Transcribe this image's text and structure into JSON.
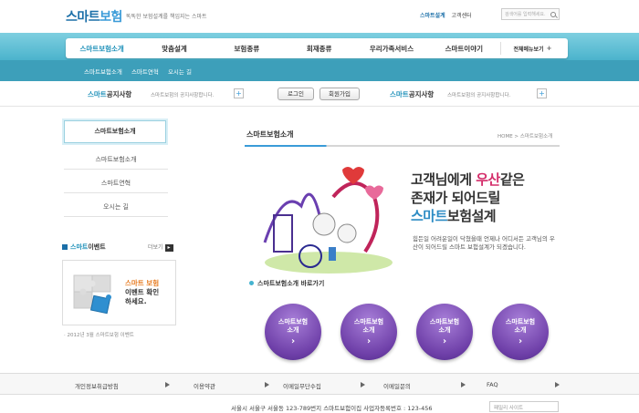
{
  "header": {
    "logo_prefix": "스마트",
    "logo_suffix": "보험",
    "tagline": "똑똑한 보험설계를 책임지는 스마트",
    "top_links": [
      "스마트설계",
      "고객센터"
    ],
    "search_placeholder": "검색어를 입력해세요."
  },
  "nav": {
    "items": [
      "스마트보험소개",
      "맞춤설계",
      "보험종류",
      "회재종류",
      "우리가족서비스",
      "스마트이야기"
    ],
    "all_menu": "전체메뉴보기"
  },
  "subnav": {
    "items": [
      "스마트보험소개",
      "스마트연혁",
      "오시는 길"
    ]
  },
  "notice_bar": {
    "left_title_hl": "스마트",
    "left_title": "공지사항",
    "left_text": "스마트보험의 공지사항합니다.",
    "login": "로그인",
    "join": "회원가입",
    "right_title_hl": "스마트",
    "right_title": "공지사항",
    "right_text": "스마트보험의 공지사항합니다."
  },
  "sidebar": {
    "title": "스마트보험소개",
    "items": [
      "스마트보험소개",
      "스마트연혁",
      "오시는 길"
    ],
    "event_title_hl": "스마트",
    "event_title": "이벤트",
    "more": "더보기",
    "event_line1": "스마트 보험",
    "event_line2": "이벤트 확인",
    "event_line3": "하세요.",
    "event_caption": "· 2012년 3월 스마트보험 이벤트"
  },
  "content": {
    "title": "스마트보험소개",
    "breadcrumb": "HOME > 스마트보험소개",
    "hero_l1_a": "고객님에게 ",
    "hero_l1_hl": "우산",
    "hero_l1_b": "같은",
    "hero_l2": "존재가 되어드릴",
    "hero_l3_hl": "스마트",
    "hero_l3": "보험설계",
    "hero_desc": "힘든일 어려운일이 닥쳤을때 언제나 어디서든 고객님의 우산이 되어드릴 스마트 보험설계가 되겠습니다.",
    "shortcut_title": "스마트보험소개 바로가기",
    "shortcut_buttons": [
      {
        "l1": "스마트보험",
        "l2": "소개"
      },
      {
        "l1": "스마트보험",
        "l2": "소개"
      },
      {
        "l1": "스마트보험",
        "l2": "소개"
      },
      {
        "l1": "스마트보험",
        "l2": "소개"
      }
    ]
  },
  "footer": {
    "links": [
      "개인정보취급방침",
      "이용약관",
      "이메일무단수집",
      "이메일문의",
      "FAQ"
    ],
    "copyright": "서울시 서울구 서울동 123-789번지 스마트보험이집 사업자등록번호 : 123-456",
    "family_site": "패밀리 사이트"
  },
  "colors": {
    "brand_blue": "#1b6fa8",
    "nav_band": "#4bb3cc",
    "accent_pink": "#d42d6a",
    "button_purple": "#6e3fa8",
    "event_orange": "#e67a1f"
  }
}
